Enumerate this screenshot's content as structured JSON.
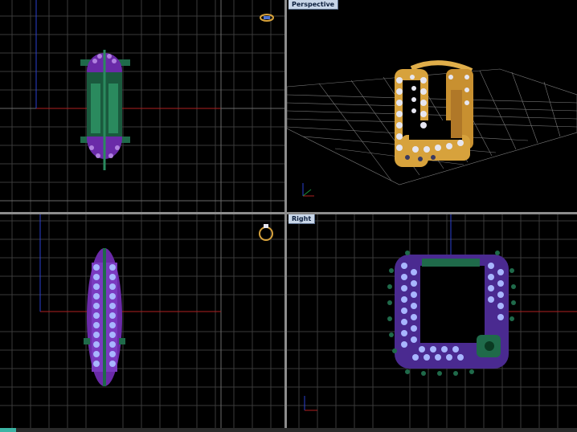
{
  "viewports": {
    "top": {
      "label": ""
    },
    "perspective": {
      "label": "Perspective"
    },
    "front": {
      "label": ""
    },
    "right": {
      "label": "Right"
    }
  },
  "colors": {
    "grid": "#3a3a3a",
    "grid_major": "#6a6a6a",
    "axis_x": "#b02020",
    "axis_y": "#2a3fd0",
    "metal_green": "#1f6a4a",
    "gem_purple": "#7a2fb8",
    "gem_light": "#a8b6ff",
    "gold": "#d7a23c",
    "diamond": "#e6e6f0"
  },
  "icons": {
    "top_widget": "ring-thumbnail-icon",
    "front_widget": "ring-thumbnail-icon",
    "axis_indicator": "xyz-axis-icon"
  }
}
